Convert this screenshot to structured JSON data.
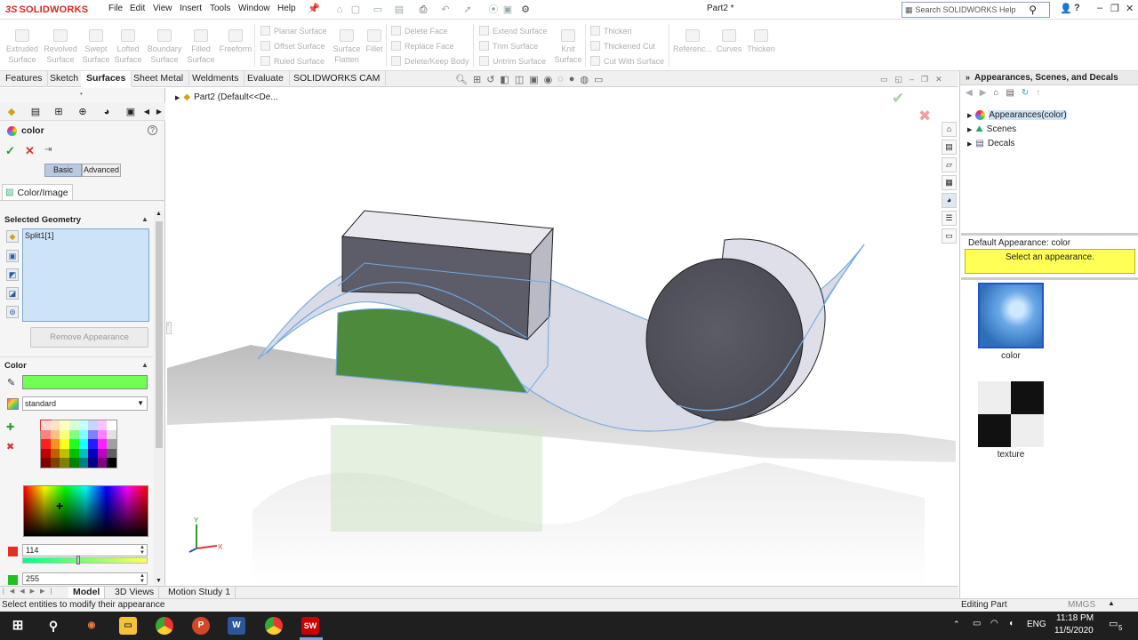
{
  "app": {
    "logo_ds": "3S",
    "logo_name": "SOLIDWORKS",
    "doc_title": "Part2 *"
  },
  "menu": [
    "File",
    "Edit",
    "View",
    "Insert",
    "Tools",
    "Window",
    "Help"
  ],
  "search": {
    "placeholder": "Search SOLIDWORKS Help"
  },
  "window_controls": {
    "help": "?",
    "minimize": "–",
    "restore": "❐",
    "close": "✕"
  },
  "command_manager": {
    "big": [
      {
        "label1": "Extruded",
        "label2": "Surface"
      },
      {
        "label1": "Revolved",
        "label2": "Surface"
      },
      {
        "label1": "Swept",
        "label2": "Surface"
      },
      {
        "label1": "Lofted",
        "label2": "Surface"
      },
      {
        "label1": "Boundary",
        "label2": "Surface"
      },
      {
        "label1": "Filled",
        "label2": "Surface"
      },
      {
        "label1": "Freeform",
        "label2": ""
      }
    ],
    "col1": [
      "Planar Surface",
      "Offset Surface",
      "Ruled Surface"
    ],
    "surface_flatten": {
      "label1": "Surface",
      "label2": "Flatten"
    },
    "fillet": "Fillet",
    "col2": [
      "Delete Face",
      "Replace Face",
      "Delete/Keep Body"
    ],
    "col3": [
      "Extend Surface",
      "Trim Surface",
      "Untrim Surface"
    ],
    "knit": {
      "label1": "Knit",
      "label2": "Surface"
    },
    "col4": [
      "Thicken",
      "Thickened Cut",
      "Cut With Surface"
    ],
    "reference": "Referenc...",
    "curves": "Curves",
    "thicken_big": "Thicken"
  },
  "tabs": [
    "Features",
    "Sketch",
    "Surfaces",
    "Sheet Metal",
    "Weldments",
    "Evaluate",
    "SOLIDWORKS CAM"
  ],
  "active_tab": "Surfaces",
  "feature_tree": {
    "root": "Part2  (Default<<De..."
  },
  "property_manager": {
    "title": "color",
    "help": "?",
    "basic": "Basic",
    "advanced": "Advanced",
    "color_image_tab": "Color/Image",
    "selected_geometry_heading": "Selected Geometry",
    "selected_items": [
      "Split1[1]"
    ],
    "remove_appearance": "Remove Appearance",
    "color_heading": "Color",
    "color_hex": "#72ff55",
    "palette": "standard",
    "rgb": {
      "r": "114",
      "g": "255",
      "r_fraction": 0.447
    }
  },
  "bottom_tabs": [
    "Model",
    "3D Views",
    "Motion Study 1"
  ],
  "status": {
    "message": "Select entities to modify their appearance",
    "mode": "Editing Part",
    "units": "MMGS"
  },
  "task_pane": {
    "title": "Appearances, Scenes, and Decals",
    "tree": [
      "Appearances(color)",
      "Scenes",
      "Decals"
    ],
    "default_appearance": "Default Appearance: color",
    "select_prompt": "Select an appearance.",
    "thumbnails": [
      "color",
      "texture"
    ]
  },
  "taskbar": {
    "time": "11:18 PM",
    "date": "11/5/2020",
    "lang": "ENG",
    "notifications": "5"
  },
  "triad": {
    "x": "X",
    "y": "Y"
  }
}
